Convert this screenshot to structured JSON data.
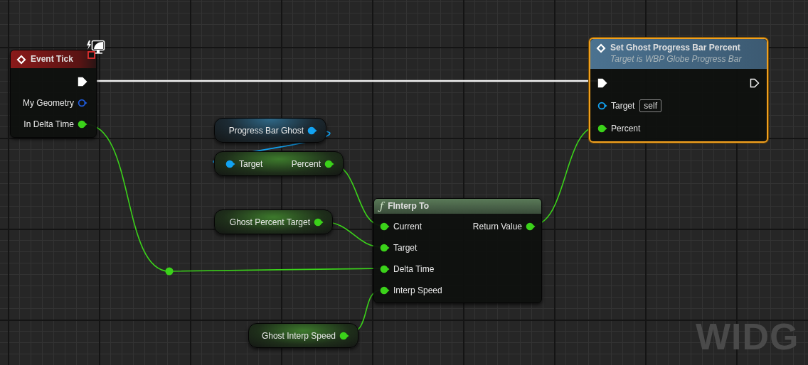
{
  "graph": {
    "nodes": [
      {
        "kind": "event",
        "title": "Event Tick",
        "selected": false,
        "rows": [
          {
            "output": {
              "kind": "exec",
              "connected": true
            }
          },
          {
            "output": {
              "kind": "struct",
              "label": "My Geometry",
              "connected": false
            }
          },
          {
            "output": {
              "kind": "float",
              "label": "In Delta Time",
              "connected": true
            }
          }
        ]
      },
      {
        "kind": "call",
        "title": "Set Ghost Progress Bar Percent",
        "subtitle": "Target is WBP Globe Progress Bar",
        "selected": true,
        "rows": [
          {
            "input": {
              "kind": "exec",
              "connected": true
            },
            "output": {
              "kind": "exec",
              "connected": false
            }
          },
          {
            "input": {
              "kind": "object",
              "label": "Target",
              "connected": false,
              "default": "self"
            }
          },
          {
            "input": {
              "kind": "float",
              "label": "Percent",
              "connected": true
            }
          }
        ]
      },
      {
        "kind": "variable",
        "selected": false,
        "rows": [
          {
            "output": {
              "kind": "object",
              "label": "Progress Bar Ghost",
              "connected": true
            }
          }
        ]
      },
      {
        "kind": "variable",
        "selected": false,
        "rows": [
          {
            "input": {
              "kind": "object",
              "label": "Target",
              "connected": true
            },
            "output": {
              "kind": "float",
              "label": "Percent",
              "connected": true
            }
          }
        ]
      },
      {
        "kind": "function",
        "icon": "ƒ",
        "title": "FInterp To",
        "selected": false,
        "rows": [
          {
            "input": {
              "kind": "float",
              "label": "Current",
              "connected": true
            },
            "output": {
              "kind": "float",
              "label": "Return Value",
              "connected": true
            }
          },
          {
            "input": {
              "kind": "float",
              "label": "Target",
              "connected": true
            }
          },
          {
            "input": {
              "kind": "float",
              "label": "Delta Time",
              "connected": true
            }
          },
          {
            "input": {
              "kind": "float",
              "label": "Interp Speed",
              "connected": true
            }
          }
        ]
      },
      {
        "kind": "variable",
        "selected": false,
        "rows": [
          {
            "output": {
              "kind": "float",
              "label": "Ghost Percent Target",
              "connected": true
            }
          }
        ]
      },
      {
        "kind": "variable",
        "selected": false,
        "rows": [
          {
            "output": {
              "kind": "float",
              "label": "Ghost Interp Speed",
              "connected": true
            }
          }
        ]
      }
    ]
  },
  "corner_label": "WIDG"
}
